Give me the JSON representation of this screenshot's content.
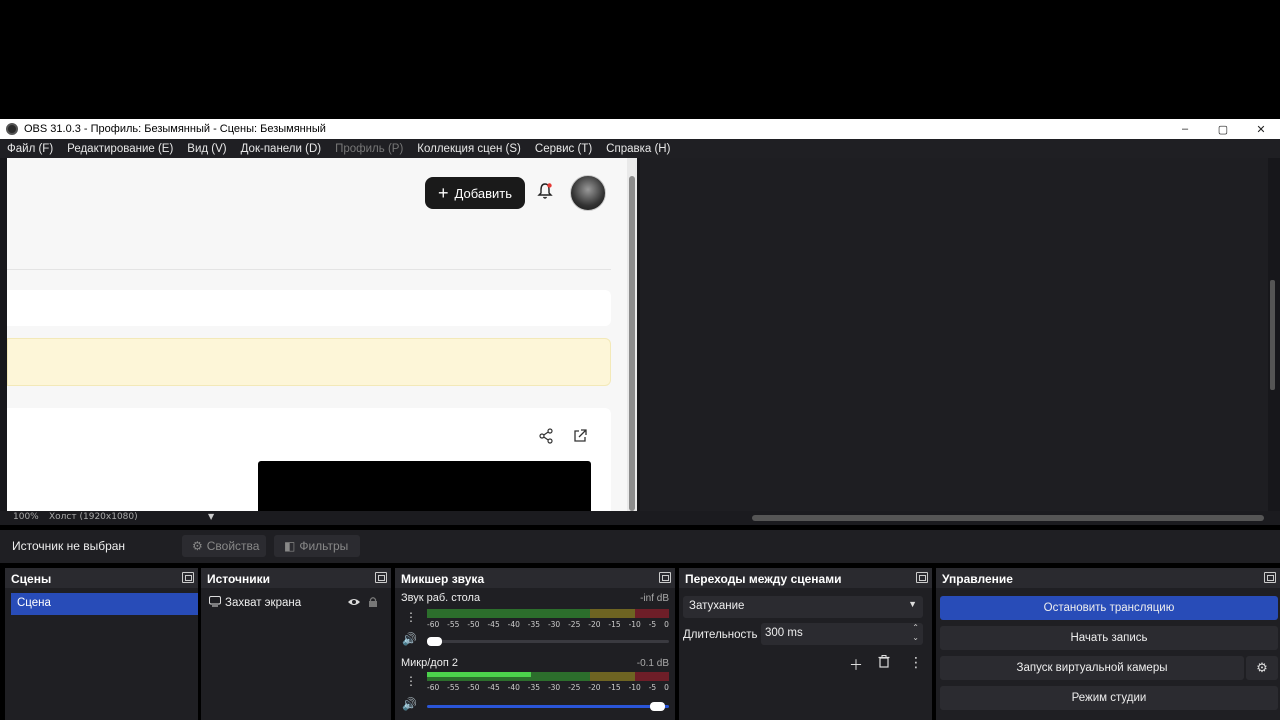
{
  "window": {
    "title": "OBS 31.0.3 - Профиль: Безымянный - Сцены: Безымянный",
    "controls": {
      "minimize": "–",
      "maximize": "▢",
      "close": "✕"
    }
  },
  "menu": [
    {
      "label": "Файл (F)",
      "enabled": true
    },
    {
      "label": "Редактирование (E)",
      "enabled": true
    },
    {
      "label": "Вид (V)",
      "enabled": true
    },
    {
      "label": "Док-панели (D)",
      "enabled": true
    },
    {
      "label": "Профиль (P)",
      "enabled": false
    },
    {
      "label": "Коллекция сцен (S)",
      "enabled": true
    },
    {
      "label": "Сервис (T)",
      "enabled": true
    },
    {
      "label": "Справка (H)",
      "enabled": true
    }
  ],
  "capture": {
    "add_button_label": "Добавить",
    "add_icon": "+",
    "bell_icon": "bell-icon",
    "share_icon": "share-icon",
    "external_icon": "external-link-icon"
  },
  "status": {
    "zoom": "100%",
    "canvas": "Холст (1920x1080)",
    "canvas_arrow": "▼"
  },
  "properties": {
    "no_source": "Источник не выбран",
    "properties_label": "Свойства",
    "filters_label": "Фильтры"
  },
  "docks": {
    "scenes": {
      "title": "Сцены",
      "items": [
        "Сцена"
      ]
    },
    "sources": {
      "title": "Источники",
      "items": [
        "Захват экрана"
      ]
    },
    "mixer": {
      "title": "Микшер звука",
      "channels": [
        {
          "name": "Звук раб. стола",
          "db": "-inf dB",
          "level": 0.0,
          "volume": 0.04
        },
        {
          "name": "Микр/доп 2",
          "db": "-0.1 dB",
          "level": 0.43,
          "volume": 1.0
        }
      ],
      "ticks": [
        "-60",
        "-55",
        "-50",
        "-45",
        "-40",
        "-35",
        "-30",
        "-25",
        "-20",
        "-15",
        "-10",
        "-5",
        "0"
      ]
    },
    "transitions": {
      "title": "Переходы между сценами",
      "selected": "Затухание",
      "duration_label": "Длительность",
      "duration_value": "300 ms"
    },
    "controls": {
      "title": "Управление",
      "buttons": [
        "Остановить трансляцию",
        "Начать запись",
        "Запуск виртуальной камеры",
        "Режим студии"
      ]
    }
  },
  "colors": {
    "accent": "#284cb8",
    "meter_green": "#3a9c3a",
    "meter_yellow": "#8a7a1a",
    "meter_red": "#8a1a2a",
    "meter_green_active": "#4cd24c"
  }
}
